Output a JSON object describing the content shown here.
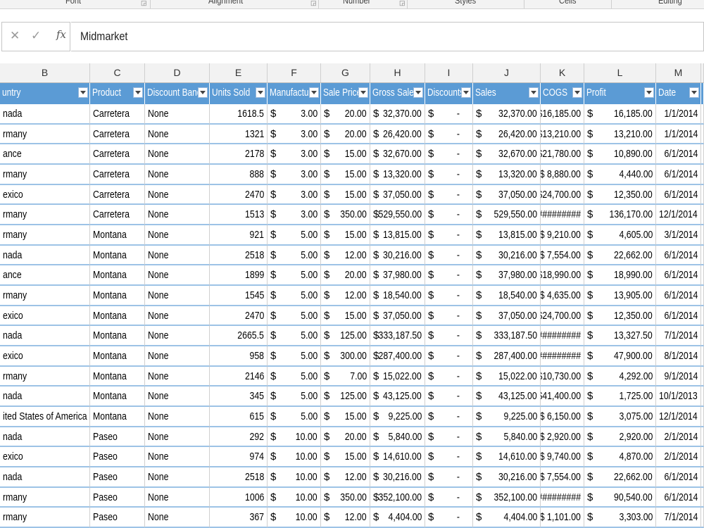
{
  "ribbon": {
    "groups": [
      "Font",
      "Alignment",
      "Number",
      "Styles",
      "Cells",
      "Editing"
    ]
  },
  "formula_bar": {
    "cancel_icon": "close-icon",
    "enter_icon": "check-icon",
    "fx_label": "fx",
    "cancel_glyph": "✕",
    "enter_glyph": "✓",
    "value": "Midmarket"
  },
  "columns": [
    "B",
    "C",
    "D",
    "E",
    "F",
    "G",
    "H",
    "I",
    "J",
    "K",
    "L",
    "M"
  ],
  "headers": [
    "untry",
    "Product",
    "Discount Band",
    "Units Sold",
    "Manufacturi",
    "Sale Price",
    "Gross Sales",
    "Discounts",
    "Sales",
    "COGS",
    "Profit",
    "Date"
  ],
  "currency_symbol": "$",
  "rows": [
    [
      "nada",
      "Carretera",
      "None",
      "1618.5",
      "3.00",
      "20.00",
      "32,370.00",
      "-",
      "32,370.00",
      "$16,185.00",
      "16,185.00",
      "1/1/2014"
    ],
    [
      "rmany",
      "Carretera",
      "None",
      "1321",
      "3.00",
      "20.00",
      "26,420.00",
      "-",
      "26,420.00",
      "$13,210.00",
      "13,210.00",
      "1/1/2014"
    ],
    [
      "ance",
      "Carretera",
      "None",
      "2178",
      "3.00",
      "15.00",
      "32,670.00",
      "-",
      "32,670.00",
      "$21,780.00",
      "10,890.00",
      "6/1/2014"
    ],
    [
      "rmany",
      "Carretera",
      "None",
      "888",
      "3.00",
      "15.00",
      "13,320.00",
      "-",
      "13,320.00",
      "$ 8,880.00",
      "4,440.00",
      "6/1/2014"
    ],
    [
      "exico",
      "Carretera",
      "None",
      "2470",
      "3.00",
      "15.00",
      "37,050.00",
      "-",
      "37,050.00",
      "$24,700.00",
      "12,350.00",
      "6/1/2014"
    ],
    [
      "rmany",
      "Carretera",
      "None",
      "1513",
      "3.00",
      "350.00",
      "529,550.00",
      "-",
      "529,550.00",
      "#########",
      "136,170.00",
      "12/1/2014"
    ],
    [
      "rmany",
      "Montana",
      "None",
      "921",
      "5.00",
      "15.00",
      "13,815.00",
      "-",
      "13,815.00",
      "$ 9,210.00",
      "4,605.00",
      "3/1/2014"
    ],
    [
      "nada",
      "Montana",
      "None",
      "2518",
      "5.00",
      "12.00",
      "30,216.00",
      "-",
      "30,216.00",
      "$ 7,554.00",
      "22,662.00",
      "6/1/2014"
    ],
    [
      "ance",
      "Montana",
      "None",
      "1899",
      "5.00",
      "20.00",
      "37,980.00",
      "-",
      "37,980.00",
      "$18,990.00",
      "18,990.00",
      "6/1/2014"
    ],
    [
      "rmany",
      "Montana",
      "None",
      "1545",
      "5.00",
      "12.00",
      "18,540.00",
      "-",
      "18,540.00",
      "$ 4,635.00",
      "13,905.00",
      "6/1/2014"
    ],
    [
      "exico",
      "Montana",
      "None",
      "2470",
      "5.00",
      "15.00",
      "37,050.00",
      "-",
      "37,050.00",
      "$24,700.00",
      "12,350.00",
      "6/1/2014"
    ],
    [
      "nada",
      "Montana",
      "None",
      "2665.5",
      "5.00",
      "125.00",
      "333,187.50",
      "-",
      "333,187.50",
      "#########",
      "13,327.50",
      "7/1/2014"
    ],
    [
      "exico",
      "Montana",
      "None",
      "958",
      "5.00",
      "300.00",
      "287,400.00",
      "-",
      "287,400.00",
      "#########",
      "47,900.00",
      "8/1/2014"
    ],
    [
      "rmany",
      "Montana",
      "None",
      "2146",
      "5.00",
      "7.00",
      "15,022.00",
      "-",
      "15,022.00",
      "$10,730.00",
      "4,292.00",
      "9/1/2014"
    ],
    [
      "nada",
      "Montana",
      "None",
      "345",
      "5.00",
      "125.00",
      "43,125.00",
      "-",
      "43,125.00",
      "$41,400.00",
      "1,725.00",
      "10/1/2013"
    ],
    [
      "ited States of America",
      "Montana",
      "None",
      "615",
      "5.00",
      "15.00",
      "9,225.00",
      "-",
      "9,225.00",
      "$ 6,150.00",
      "3,075.00",
      "12/1/2014"
    ],
    [
      "nada",
      "Paseo",
      "None",
      "292",
      "10.00",
      "20.00",
      "5,840.00",
      "-",
      "5,840.00",
      "$ 2,920.00",
      "2,920.00",
      "2/1/2014"
    ],
    [
      "exico",
      "Paseo",
      "None",
      "974",
      "10.00",
      "15.00",
      "14,610.00",
      "-",
      "14,610.00",
      "$ 9,740.00",
      "4,870.00",
      "2/1/2014"
    ],
    [
      "nada",
      "Paseo",
      "None",
      "2518",
      "10.00",
      "12.00",
      "30,216.00",
      "-",
      "30,216.00",
      "$ 7,554.00",
      "22,662.00",
      "6/1/2014"
    ],
    [
      "rmany",
      "Paseo",
      "None",
      "1006",
      "10.00",
      "350.00",
      "352,100.00",
      "-",
      "352,100.00",
      "#########",
      "90,540.00",
      "6/1/2014"
    ],
    [
      "rmany",
      "Paseo",
      "None",
      "367",
      "10.00",
      "12.00",
      "4,404.00",
      "-",
      "4,404.00",
      "$ 1,101.00",
      "3,303.00",
      "7/1/2014"
    ]
  ],
  "colors": {
    "header_fill": "#5b9bd5",
    "row_border": "#9dc3e6",
    "column_header_fill": "#f2f2f2"
  }
}
